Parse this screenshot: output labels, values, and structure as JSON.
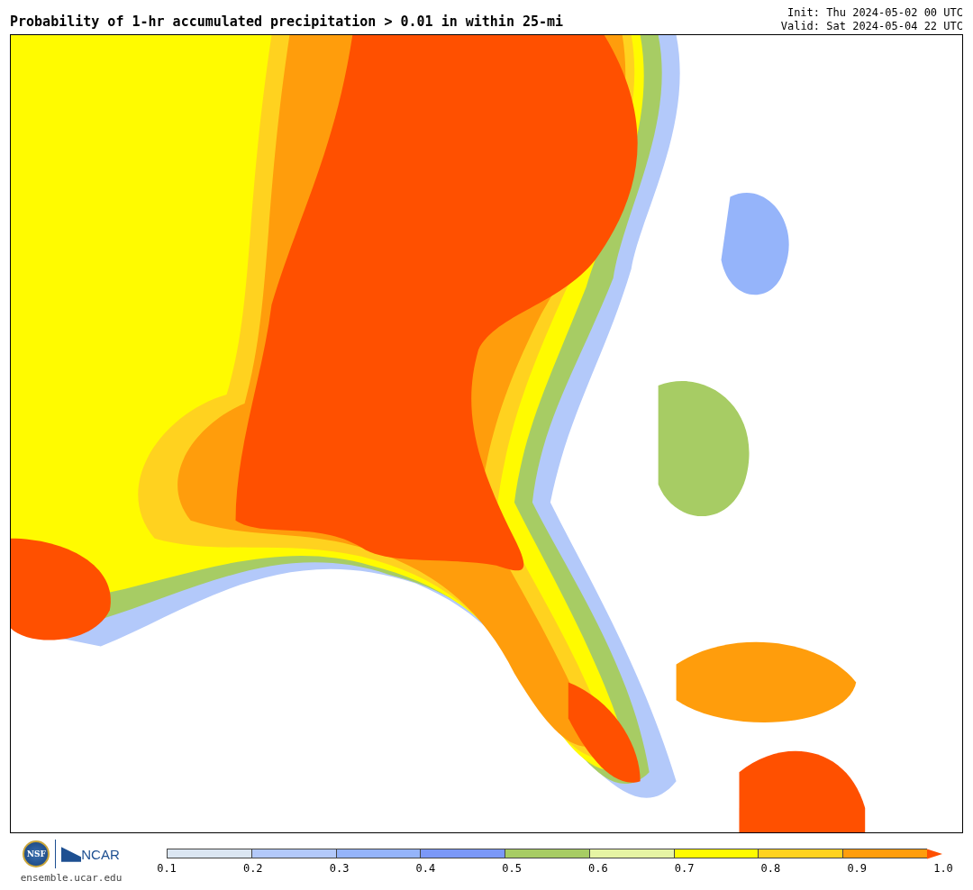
{
  "title": "Probability of 1-hr accumulated precipitation > 0.01 in within 25-mi",
  "init": "Init: Thu 2024-05-02 00 UTC",
  "valid": "Valid: Sat 2024-05-04 22 UTC",
  "logos": {
    "nsf": "NSF",
    "ncar": "NCAR",
    "url": "ensemble.ucar.edu"
  },
  "colorbar": {
    "extension": {
      "color": "#ff5000"
    },
    "segments": [
      {
        "color": "#dbe6f2"
      },
      {
        "color": "#b3c9fa"
      },
      {
        "color": "#95b4fa"
      },
      {
        "color": "#7b98f7"
      },
      {
        "color": "#a7cc64"
      },
      {
        "color": "#e6f4a4"
      },
      {
        "color": "#fffb00"
      },
      {
        "color": "#ffd21f"
      },
      {
        "color": "#ff9d0c"
      }
    ],
    "ticks": [
      "0.1",
      "0.2",
      "0.3",
      "0.4",
      "0.5",
      "0.6",
      "0.7",
      "0.8",
      "0.9",
      "1.0"
    ]
  }
}
